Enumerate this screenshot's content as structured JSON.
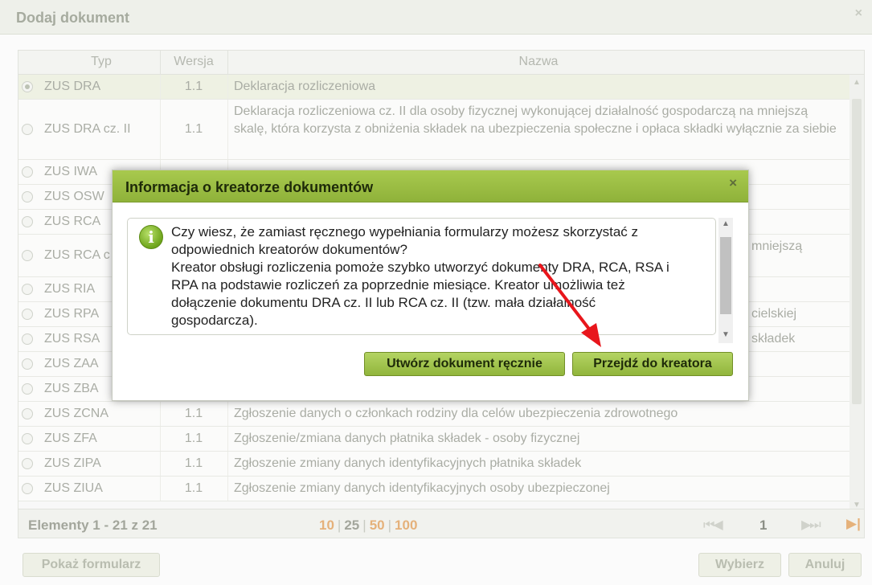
{
  "window": {
    "title": "Dodaj dokument",
    "close_glyph": "×"
  },
  "grid": {
    "columns": [
      "Typ",
      "Wersja",
      "Nazwa"
    ],
    "rows": [
      {
        "typ": "ZUS DRA",
        "wersja": "1.1",
        "nazwa": "Deklaracja rozliczeniowa"
      },
      {
        "typ": "ZUS DRA cz. II",
        "wersja": "1.1",
        "nazwa": "Deklaracja rozliczeniowa cz. II dla osoby fizycznej wykonującej działalność gospodarczą na mniejszą skalę, która korzysta z obniżenia składek na ubezpieczenia społeczne i opłaca składki wyłącznie za siebie"
      },
      {
        "typ": "ZUS IWA",
        "wersja": "",
        "nazwa": ""
      },
      {
        "typ": "ZUS OSW",
        "wersja": "",
        "nazwa": ""
      },
      {
        "typ": "ZUS RCA",
        "wersja": "",
        "nazwa": ""
      },
      {
        "typ": "ZUS RCA c",
        "wersja": "",
        "nazwa": "mniejszą"
      },
      {
        "typ": "ZUS RIA",
        "wersja": "",
        "nazwa": ""
      },
      {
        "typ": "ZUS RPA",
        "wersja": "",
        "nazwa": "cielskiej"
      },
      {
        "typ": "ZUS RSA",
        "wersja": "",
        "nazwa": "składek"
      },
      {
        "typ": "ZUS ZAA",
        "wersja": "",
        "nazwa": ""
      },
      {
        "typ": "ZUS ZBA",
        "wersja": "",
        "nazwa": ""
      },
      {
        "typ": "ZUS ZCNA",
        "wersja": "1.1",
        "nazwa": "Zgłoszenie danych o członkach rodziny dla celów ubezpieczenia zdrowotnego"
      },
      {
        "typ": "ZUS ZFA",
        "wersja": "1.1",
        "nazwa": "Zgłoszenie/zmiana danych płatnika składek - osoby fizycznej"
      },
      {
        "typ": "ZUS ZIPA",
        "wersja": "1.1",
        "nazwa": "Zgłoszenie zmiany danych identyfikacyjnych płatnika składek"
      },
      {
        "typ": "ZUS ZIUA",
        "wersja": "1.1",
        "nazwa": "Zgłoszenie zmiany danych identyfikacyjnych osoby ubezpieczonej"
      }
    ]
  },
  "pager": {
    "count_label": "Elementy 1 - 21 z 21",
    "sizes": [
      "10",
      "25",
      "50",
      "100"
    ],
    "current_size": "25",
    "page": "1",
    "first_glyph": "⏮◀",
    "last_glyph": "▶⏭",
    "end_glyph": "▶|"
  },
  "footer": {
    "show_form": "Pokaż formularz",
    "choose": "Wybierz",
    "cancel": "Anuluj"
  },
  "dialog": {
    "title": "Informacja o kreatorze dokumentów",
    "close_glyph": "×",
    "icon_glyph": "i",
    "message_lines": [
      "Czy wiesz, że zamiast ręcznego wypełniania formularzy możesz skorzystać z",
      "odpowiednich kreatorów dokumentów?",
      "Kreator obsługi rozliczenia pomoże szybko utworzyć dokumenty DRA, RCA, RSA i",
      "RPA na podstawie rozliczeń za poprzednie miesiące. Kreator umożliwia też",
      "dołączenie dokumentu DRA cz. II lub RCA cz. II (tzw. mała działalność",
      "gospodarcza)."
    ],
    "btn_manual": "Utwórz dokument ręcznie",
    "btn_wizard": "Przejdź do kreatora"
  },
  "colors": {
    "accent_green": "#9dc045",
    "arrow_red": "#e8161c",
    "pager_orange": "#e5b17a"
  }
}
